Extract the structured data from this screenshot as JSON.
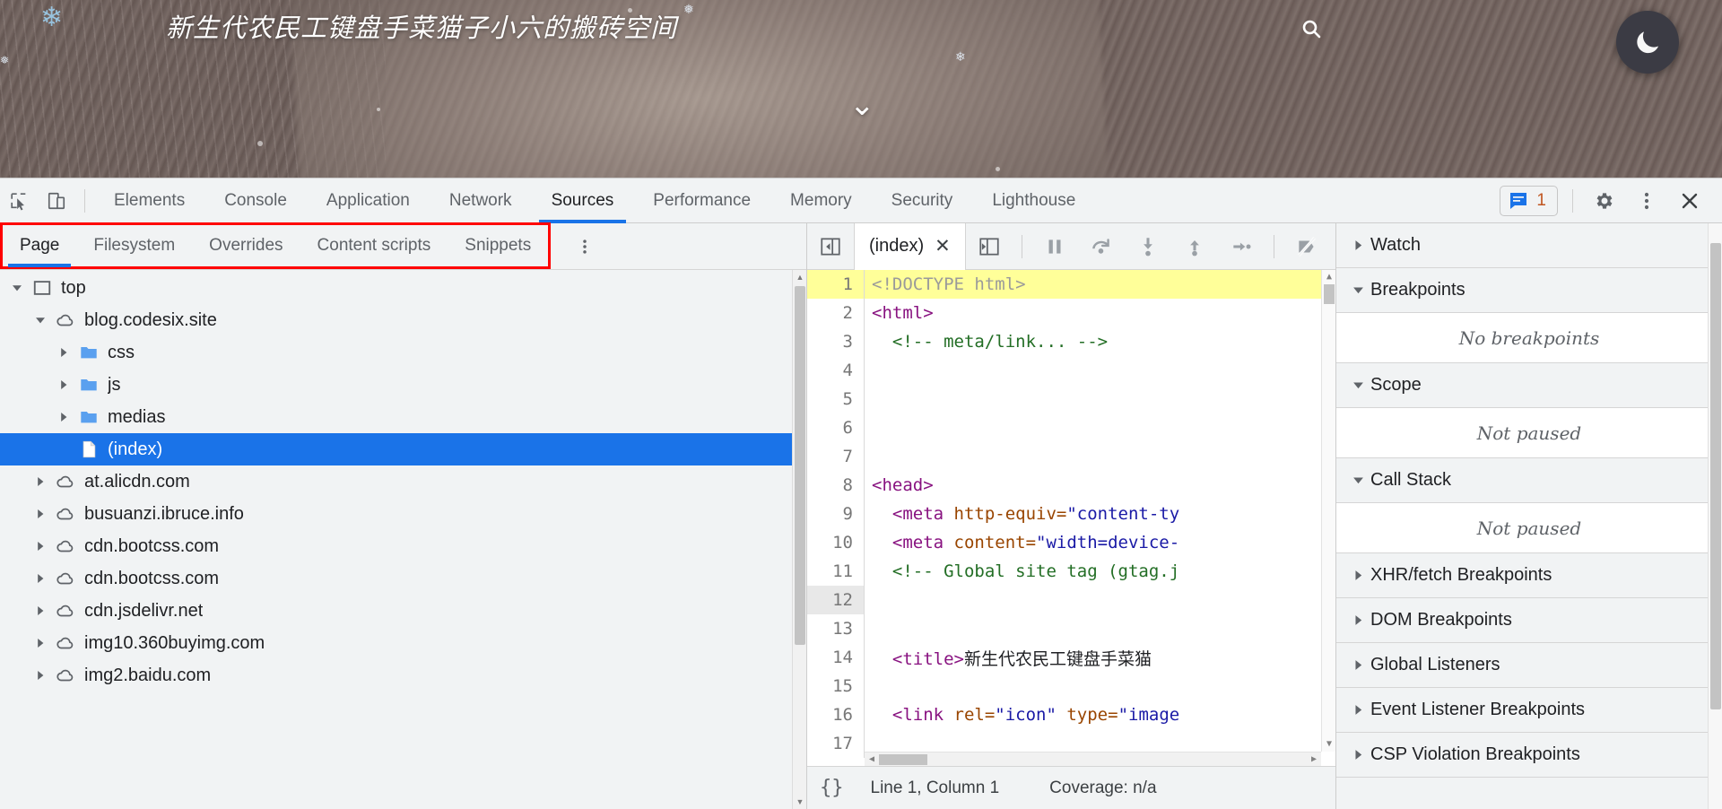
{
  "banner": {
    "site_title": "新生代农民工键盘手菜猫子小六的搬砖空间",
    "search_icon": "search-icon",
    "theme_icon": "moon-icon",
    "scroll_icon": "chevron-down-icon",
    "accent_color": "#1a73e8",
    "highlight_color": "#ff0000"
  },
  "devtools": {
    "toolbar_icons": [
      "inspect-element-icon",
      "device-toolbar-icon"
    ],
    "tabs": [
      {
        "label": "Elements",
        "active": false
      },
      {
        "label": "Console",
        "active": false
      },
      {
        "label": "Application",
        "active": false
      },
      {
        "label": "Network",
        "active": false
      },
      {
        "label": "Sources",
        "active": true
      },
      {
        "label": "Performance",
        "active": false
      },
      {
        "label": "Memory",
        "active": false
      },
      {
        "label": "Security",
        "active": false
      },
      {
        "label": "Lighthouse",
        "active": false
      }
    ],
    "message_badge": {
      "icon": "message-icon",
      "count": "1"
    },
    "right_icons": [
      "settings-gear-icon",
      "more-vertical-icon",
      "close-icon"
    ]
  },
  "navigator": {
    "tabs": [
      {
        "label": "Page",
        "active": true
      },
      {
        "label": "Filesystem",
        "active": false
      },
      {
        "label": "Overrides",
        "active": false
      },
      {
        "label": "Content scripts",
        "active": false
      },
      {
        "label": "Snippets",
        "active": false
      }
    ],
    "more_icon": "more-vertical-icon",
    "tree": [
      {
        "label": "top",
        "icon": "frame-icon",
        "depth": 0,
        "arrow": "down",
        "selected": false
      },
      {
        "label": "blog.codesix.site",
        "icon": "cloud-icon",
        "depth": 1,
        "arrow": "down",
        "selected": false
      },
      {
        "label": "css",
        "icon": "folder-icon",
        "depth": 2,
        "arrow": "right",
        "selected": false
      },
      {
        "label": "js",
        "icon": "folder-icon",
        "depth": 2,
        "arrow": "right",
        "selected": false
      },
      {
        "label": "medias",
        "icon": "folder-icon",
        "depth": 2,
        "arrow": "right",
        "selected": false
      },
      {
        "label": "(index)",
        "icon": "document-icon",
        "depth": 2,
        "arrow": "none",
        "selected": true
      },
      {
        "label": "at.alicdn.com",
        "icon": "cloud-icon",
        "depth": 1,
        "arrow": "right",
        "selected": false
      },
      {
        "label": "busuanzi.ibruce.info",
        "icon": "cloud-icon",
        "depth": 1,
        "arrow": "right",
        "selected": false
      },
      {
        "label": "cdn.bootcss.com",
        "icon": "cloud-icon",
        "depth": 1,
        "arrow": "right",
        "selected": false
      },
      {
        "label": "cdn.bootcss.com",
        "icon": "cloud-icon",
        "depth": 1,
        "arrow": "right",
        "selected": false
      },
      {
        "label": "cdn.jsdelivr.net",
        "icon": "cloud-icon",
        "depth": 1,
        "arrow": "right",
        "selected": false
      },
      {
        "label": "img10.360buyimg.com",
        "icon": "cloud-icon",
        "depth": 1,
        "arrow": "right",
        "selected": false
      },
      {
        "label": "img2.baidu.com",
        "icon": "cloud-icon",
        "depth": 1,
        "arrow": "right",
        "selected": false
      }
    ]
  },
  "editor": {
    "panel_toggle_icon": "show-navigator-icon",
    "file_tab": {
      "name": "(index)",
      "close": "✕"
    },
    "debug_toolbar": [
      "show-debugger-sidebar-icon",
      "pause-icon",
      "step-over-icon",
      "step-into-icon",
      "step-out-icon",
      "step-icon",
      "deactivate-breakpoints-icon",
      "pause-on-exceptions-icon"
    ],
    "lines": [
      {
        "n": "1",
        "highlight": true,
        "current": false,
        "spans": [
          {
            "t": "<!DOCTYPE html>",
            "c": "t-doctype"
          }
        ]
      },
      {
        "n": "2",
        "highlight": false,
        "current": false,
        "spans": [
          {
            "t": "<html>",
            "c": "t-tag"
          }
        ]
      },
      {
        "n": "3",
        "highlight": false,
        "current": false,
        "spans": [
          {
            "t": "  <!-- meta/link... -->",
            "c": "t-comment"
          }
        ]
      },
      {
        "n": "4",
        "highlight": false,
        "current": false,
        "spans": []
      },
      {
        "n": "5",
        "highlight": false,
        "current": false,
        "spans": []
      },
      {
        "n": "6",
        "highlight": false,
        "current": false,
        "spans": []
      },
      {
        "n": "7",
        "highlight": false,
        "current": false,
        "spans": []
      },
      {
        "n": "8",
        "highlight": false,
        "current": false,
        "spans": [
          {
            "t": "<head>",
            "c": "t-tag"
          }
        ]
      },
      {
        "n": "9",
        "highlight": false,
        "current": false,
        "spans": [
          {
            "t": "  <meta ",
            "c": "t-tag"
          },
          {
            "t": "http-equiv=",
            "c": "t-attr"
          },
          {
            "t": "\"content-ty",
            "c": "t-val"
          }
        ]
      },
      {
        "n": "10",
        "highlight": false,
        "current": false,
        "spans": [
          {
            "t": "  <meta ",
            "c": "t-tag"
          },
          {
            "t": "content=",
            "c": "t-attr"
          },
          {
            "t": "\"width=device-",
            "c": "t-val"
          }
        ]
      },
      {
        "n": "11",
        "highlight": false,
        "current": false,
        "spans": [
          {
            "t": "  <!-- Global site tag (gtag.j",
            "c": "t-comment"
          }
        ]
      },
      {
        "n": "12",
        "highlight": false,
        "current": true,
        "spans": []
      },
      {
        "n": "13",
        "highlight": false,
        "current": false,
        "spans": []
      },
      {
        "n": "14",
        "highlight": false,
        "current": false,
        "spans": [
          {
            "t": "  <title>",
            "c": "t-tag"
          },
          {
            "t": "新生代农民工键盘手菜猫",
            "c": "t-text"
          }
        ]
      },
      {
        "n": "15",
        "highlight": false,
        "current": false,
        "spans": []
      },
      {
        "n": "16",
        "highlight": false,
        "current": false,
        "spans": [
          {
            "t": "  <link ",
            "c": "t-tag"
          },
          {
            "t": "rel=",
            "c": "t-attr"
          },
          {
            "t": "\"icon\"",
            "c": "t-val"
          },
          {
            "t": " type=",
            "c": "t-attr"
          },
          {
            "t": "\"image",
            "c": "t-val"
          }
        ]
      },
      {
        "n": "17",
        "highlight": false,
        "current": false,
        "spans": []
      }
    ],
    "status": {
      "format_icon": "pretty-print-icon",
      "position": "Line 1, Column 1",
      "coverage": "Coverage: n/a"
    }
  },
  "debugger": {
    "sections": [
      {
        "label": "Watch",
        "arrow": "right",
        "body": null
      },
      {
        "label": "Breakpoints",
        "arrow": "down",
        "body": "No breakpoints"
      },
      {
        "label": "Scope",
        "arrow": "down",
        "body": "Not paused"
      },
      {
        "label": "Call Stack",
        "arrow": "down",
        "body": "Not paused"
      },
      {
        "label": "XHR/fetch Breakpoints",
        "arrow": "right",
        "body": null
      },
      {
        "label": "DOM Breakpoints",
        "arrow": "right",
        "body": null
      },
      {
        "label": "Global Listeners",
        "arrow": "right",
        "body": null
      },
      {
        "label": "Event Listener Breakpoints",
        "arrow": "right",
        "body": null
      },
      {
        "label": "CSP Violation Breakpoints",
        "arrow": "right",
        "body": null
      }
    ]
  }
}
